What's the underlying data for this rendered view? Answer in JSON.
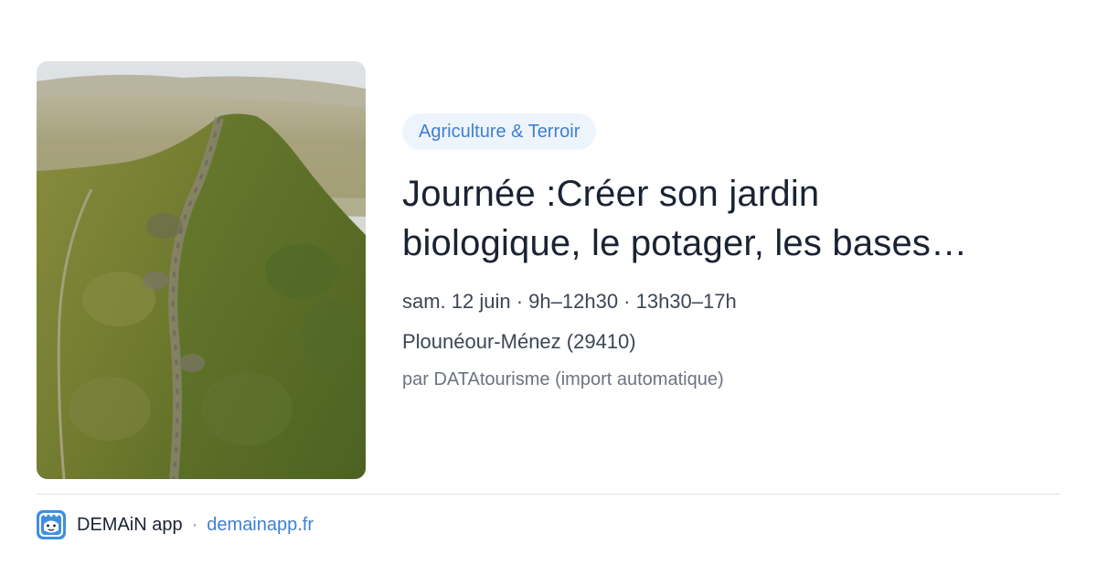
{
  "event": {
    "image_icon": "landscape-photo",
    "category": "Agriculture & Terroir",
    "title_line1": "Journée :Créer son jardin",
    "title_line2": "biologique, le potager, les bases…",
    "when": "sam. 12 juin · 9h–12h30 · 13h30–17h",
    "where": "Plounéour-Ménez (29410)",
    "source": "par DATAtourisme (import automatique)"
  },
  "footer": {
    "app_icon": "demain-app-logo",
    "app_name": "DEMAiN app",
    "separator": "·",
    "app_url": "demainapp.fr"
  },
  "colors": {
    "accent": "#3f7fd4",
    "category_bg": "#eef4fc",
    "title": "#1a2333",
    "muted": "#6b7480"
  }
}
